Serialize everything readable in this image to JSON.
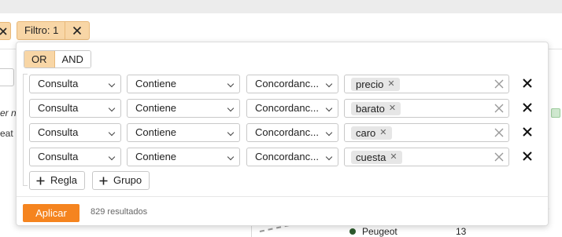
{
  "filter_chip": {
    "label": "Filtro: 1"
  },
  "background": {
    "text1": "er n",
    "text2": "eat",
    "legend_label": "Peugeot",
    "legend_count": "13"
  },
  "popup": {
    "toggle": {
      "or_label": "OR",
      "and_label": "AND",
      "active": "OR"
    },
    "rules": [
      {
        "field": "Consulta",
        "operator": "Contiene",
        "match": "Concordanc...",
        "value": "precio"
      },
      {
        "field": "Consulta",
        "operator": "Contiene",
        "match": "Concordanc...",
        "value": "barato"
      },
      {
        "field": "Consulta",
        "operator": "Contiene",
        "match": "Concordanc...",
        "value": "caro"
      },
      {
        "field": "Consulta",
        "operator": "Contiene",
        "match": "Concordanc...",
        "value": "cuesta"
      }
    ],
    "add_rule_label": "Regla",
    "add_group_label": "Grupo",
    "apply_label": "Aplicar",
    "results_text": "829 resultados"
  },
  "colors": {
    "accent": "#f5841f",
    "chip_bg": "#f8d6a6"
  }
}
